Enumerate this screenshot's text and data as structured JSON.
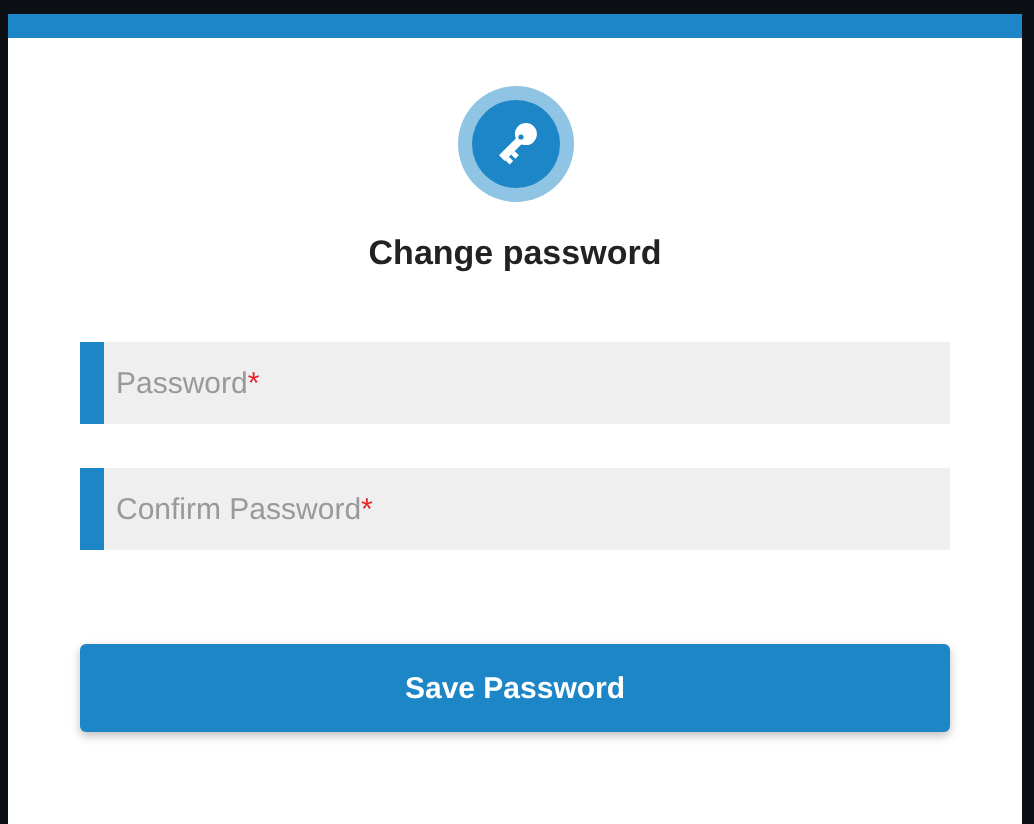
{
  "dialog": {
    "title": "Change password"
  },
  "fields": [
    {
      "placeholder": "Password",
      "required_mark": "*"
    },
    {
      "placeholder": "Confirm Password",
      "required_mark": "*"
    }
  ],
  "button": {
    "label": "Save Password"
  }
}
